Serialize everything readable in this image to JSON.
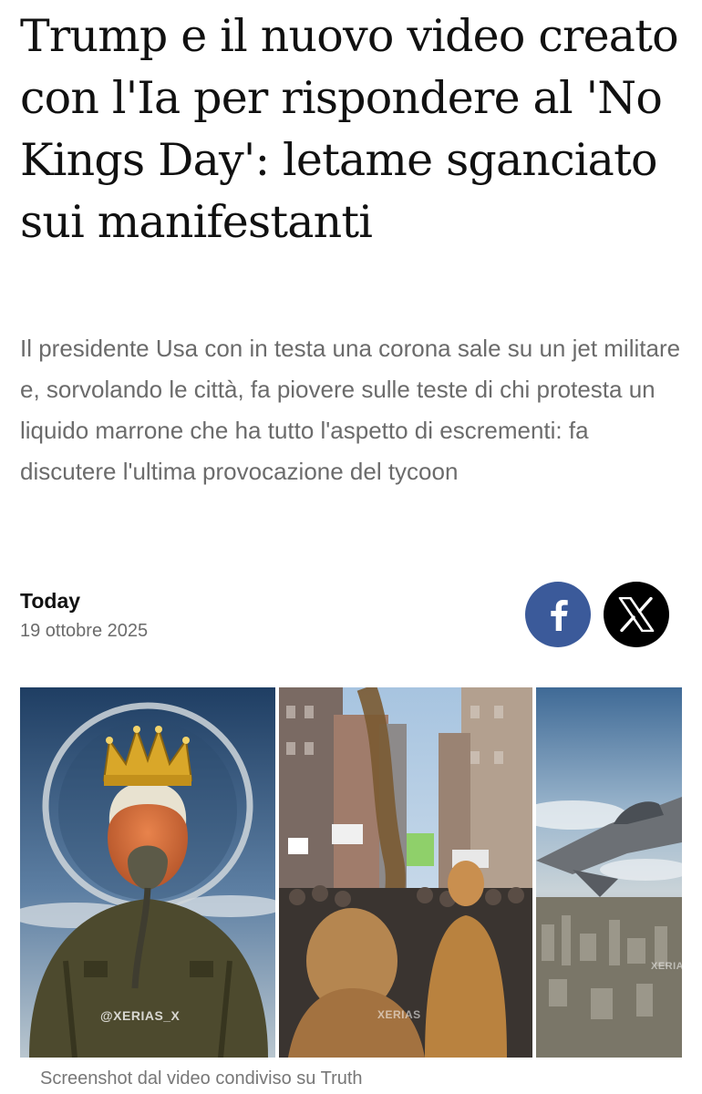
{
  "article": {
    "headline": "Trump e il nuovo video creato con l'Ia per rispondere al 'No Kings Day': letame sganciato sui manifestanti",
    "summary": "Il presidente Usa con in testa una corona sale su un jet militare e, sorvolando le città, fa piovere sulle teste di chi protesta un liquido marrone che ha tutto l'aspetto di escrementi: fa discutere l'ultima provocazione del tycoon",
    "byline": {
      "source": "Today",
      "date": "19 ottobre 2025"
    },
    "share": [
      {
        "network": "facebook",
        "icon": "facebook-icon",
        "color": "#3b5a9a"
      },
      {
        "network": "x",
        "icon": "x-logo-icon",
        "color": "#000000"
      }
    ],
    "image": {
      "watermark": "@XERIAS_X",
      "watermark_partial": "XERIAS",
      "caption": "Screenshot dal video condiviso su Truth"
    }
  }
}
